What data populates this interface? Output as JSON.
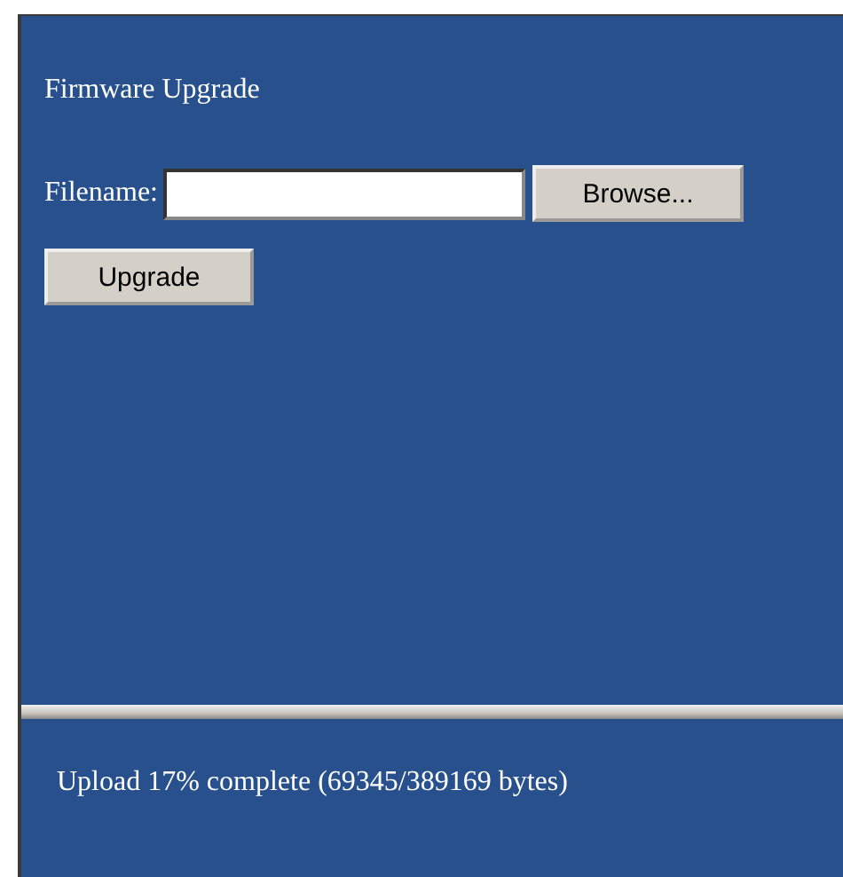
{
  "upgrade_panel": {
    "title": "Firmware Upgrade",
    "filename_label": "Filename:",
    "browse_button": "Browse...",
    "upgrade_button": "Upgrade"
  },
  "status_panel": {
    "message": "Upload 17% complete (69345/389169 bytes)"
  }
}
